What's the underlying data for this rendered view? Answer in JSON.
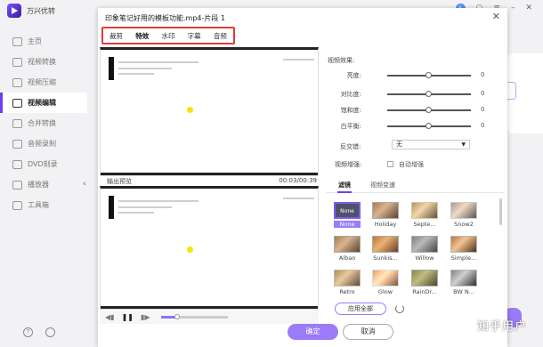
{
  "app": {
    "name": "万兴优转",
    "avatar_text": "S"
  },
  "sidebar": {
    "items": [
      {
        "label": "主页",
        "active": false
      },
      {
        "label": "视频转换",
        "active": false
      },
      {
        "label": "视频压缩",
        "active": false
      },
      {
        "label": "视频编辑",
        "active": true
      },
      {
        "label": "合并转换",
        "active": false
      },
      {
        "label": "音频录制",
        "active": false
      },
      {
        "label": "DVD刻录",
        "active": false
      },
      {
        "label": "播放器",
        "active": false
      },
      {
        "label": "工具箱",
        "active": false
      }
    ]
  },
  "dialog": {
    "title": "印象笔记好用的模板功能.mp4-片段 1",
    "tabs": [
      "裁剪",
      "特效",
      "水印",
      "字幕",
      "音频"
    ],
    "active_tab": "特效",
    "output_preview_label": "输出预览",
    "time": "00:03/00:39",
    "effects": {
      "section_label": "视频效果:",
      "adjustments": [
        {
          "label": "亮度:",
          "value": "0"
        },
        {
          "label": "对比度:",
          "value": "0"
        },
        {
          "label": "饱和度:",
          "value": "0"
        },
        {
          "label": "白平衡:",
          "value": "0"
        }
      ],
      "deinterlace_label": "反交错:",
      "deinterlace_value": "无",
      "enhance_label": "视频增强:",
      "auto_enhance_label": "自动增强"
    },
    "sub_tabs": [
      "滤镜",
      "视频变速"
    ],
    "filters": [
      "None",
      "Holiday",
      "Septe...",
      "Snow2",
      "Aibao",
      "Sunkis...",
      "Willow",
      "Simple...",
      "Retro",
      "Glow",
      "RainDr...",
      "BW N..."
    ],
    "selected_filter": "None",
    "apply_all_label": "应用全部",
    "ok_label": "确定",
    "cancel_label": "取消"
  },
  "playback": {
    "progress": 0.25
  },
  "watermark": "知乎用户"
}
